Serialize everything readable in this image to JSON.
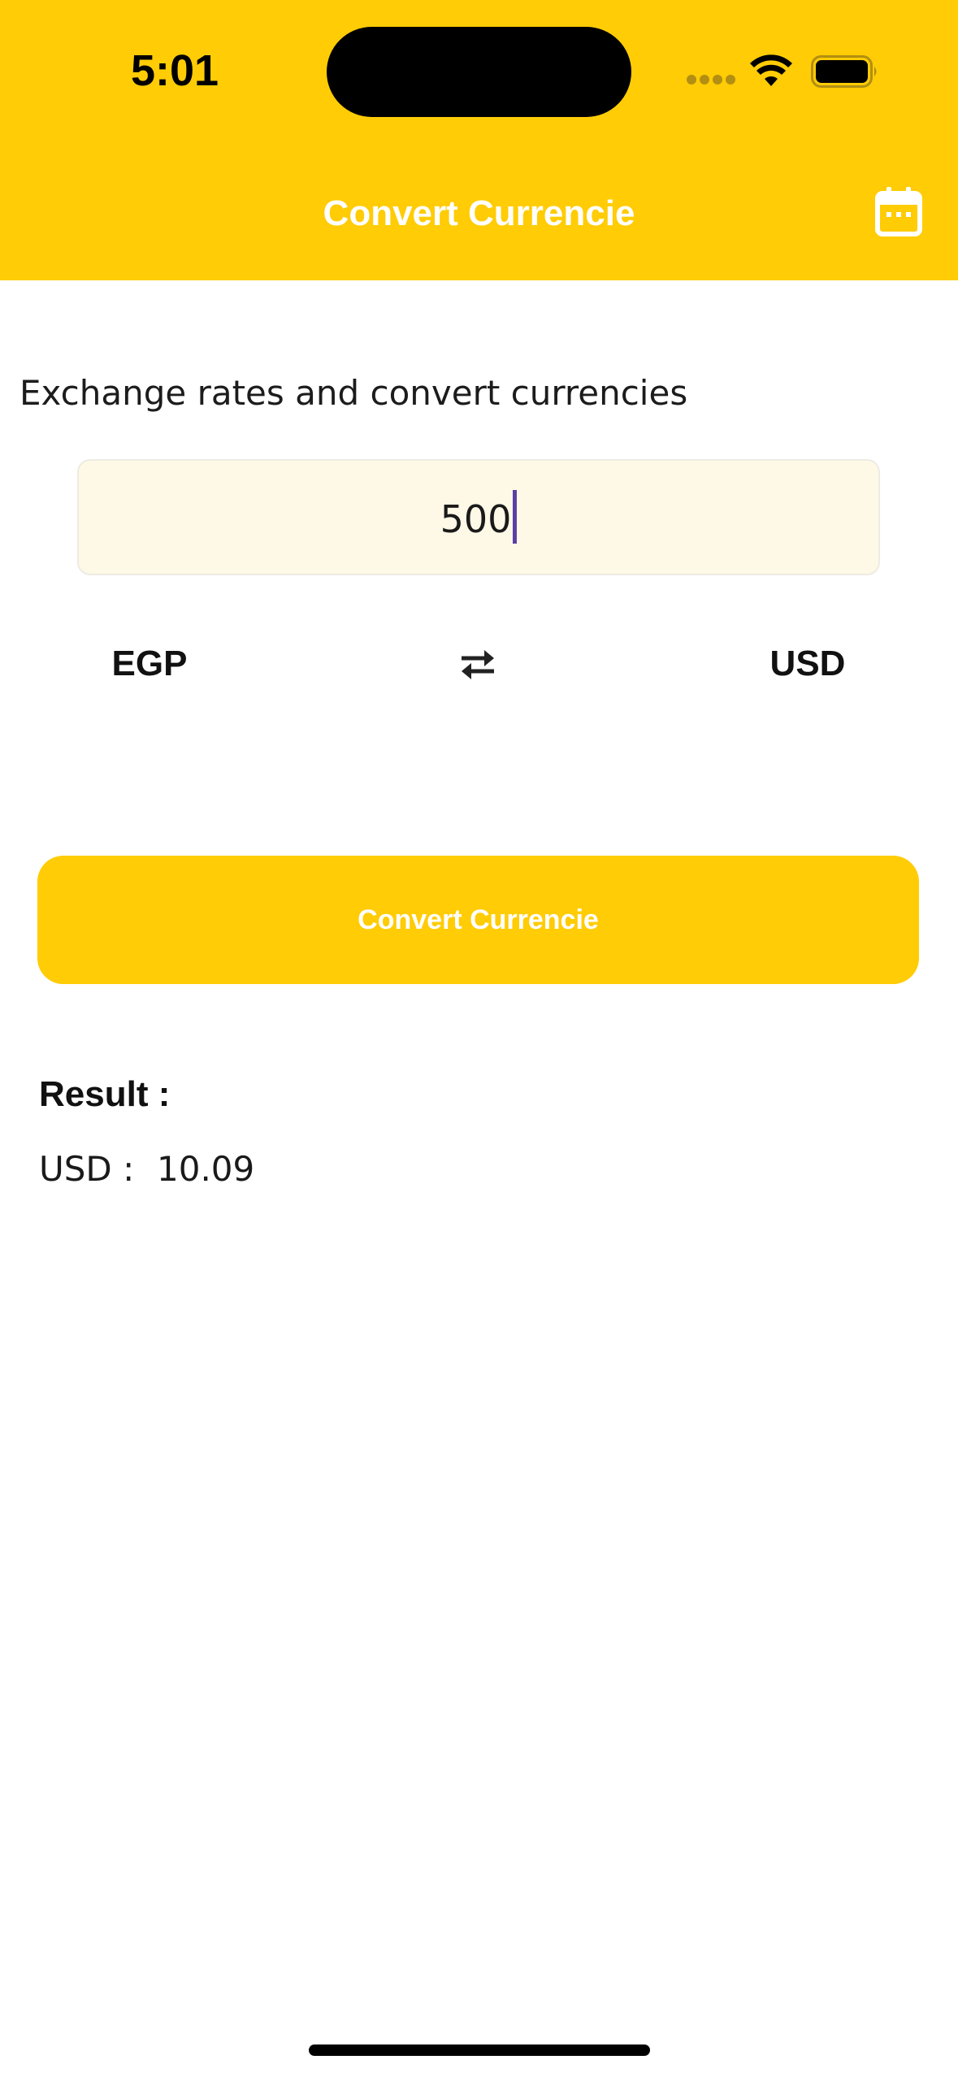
{
  "status_bar": {
    "time": "5:01"
  },
  "header": {
    "title": "Convert Currencie",
    "background_color": "#FFCC05",
    "calendar_icon": "calendar-icon"
  },
  "subtitle": "Exchange rates and convert currencies",
  "amount_input": {
    "value": "500"
  },
  "currency_pair": {
    "from": "EGP",
    "to": "USD",
    "swap_icon": "swap-arrows-icon"
  },
  "convert_button": {
    "label": "Convert Currencie"
  },
  "result": {
    "label": "Result :",
    "currency": "USD :",
    "value": "10.09"
  },
  "colors": {
    "accent": "#FFCC05",
    "input_background": "#FEF9E6",
    "caret": "#5B3FA6"
  }
}
